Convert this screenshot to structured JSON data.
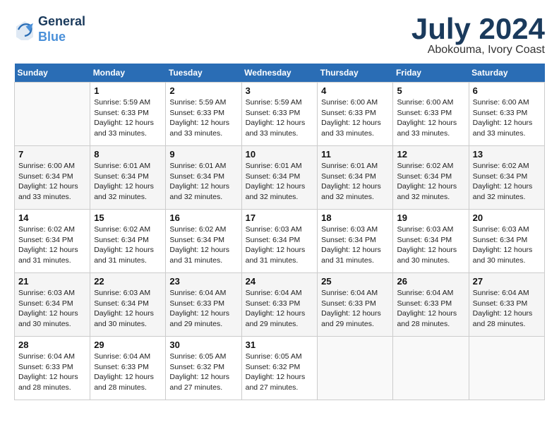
{
  "header": {
    "logo_line1": "General",
    "logo_line2": "Blue",
    "month_title": "July 2024",
    "location": "Abokouma, Ivory Coast"
  },
  "days_of_week": [
    "Sunday",
    "Monday",
    "Tuesday",
    "Wednesday",
    "Thursday",
    "Friday",
    "Saturday"
  ],
  "weeks": [
    [
      {
        "day": "",
        "info": ""
      },
      {
        "day": "1",
        "info": "Sunrise: 5:59 AM\nSunset: 6:33 PM\nDaylight: 12 hours\nand 33 minutes."
      },
      {
        "day": "2",
        "info": "Sunrise: 5:59 AM\nSunset: 6:33 PM\nDaylight: 12 hours\nand 33 minutes."
      },
      {
        "day": "3",
        "info": "Sunrise: 5:59 AM\nSunset: 6:33 PM\nDaylight: 12 hours\nand 33 minutes."
      },
      {
        "day": "4",
        "info": "Sunrise: 6:00 AM\nSunset: 6:33 PM\nDaylight: 12 hours\nand 33 minutes."
      },
      {
        "day": "5",
        "info": "Sunrise: 6:00 AM\nSunset: 6:33 PM\nDaylight: 12 hours\nand 33 minutes."
      },
      {
        "day": "6",
        "info": "Sunrise: 6:00 AM\nSunset: 6:33 PM\nDaylight: 12 hours\nand 33 minutes."
      }
    ],
    [
      {
        "day": "7",
        "info": "Sunrise: 6:00 AM\nSunset: 6:34 PM\nDaylight: 12 hours\nand 33 minutes."
      },
      {
        "day": "8",
        "info": "Sunrise: 6:01 AM\nSunset: 6:34 PM\nDaylight: 12 hours\nand 32 minutes."
      },
      {
        "day": "9",
        "info": "Sunrise: 6:01 AM\nSunset: 6:34 PM\nDaylight: 12 hours\nand 32 minutes."
      },
      {
        "day": "10",
        "info": "Sunrise: 6:01 AM\nSunset: 6:34 PM\nDaylight: 12 hours\nand 32 minutes."
      },
      {
        "day": "11",
        "info": "Sunrise: 6:01 AM\nSunset: 6:34 PM\nDaylight: 12 hours\nand 32 minutes."
      },
      {
        "day": "12",
        "info": "Sunrise: 6:02 AM\nSunset: 6:34 PM\nDaylight: 12 hours\nand 32 minutes."
      },
      {
        "day": "13",
        "info": "Sunrise: 6:02 AM\nSunset: 6:34 PM\nDaylight: 12 hours\nand 32 minutes."
      }
    ],
    [
      {
        "day": "14",
        "info": "Sunrise: 6:02 AM\nSunset: 6:34 PM\nDaylight: 12 hours\nand 31 minutes."
      },
      {
        "day": "15",
        "info": "Sunrise: 6:02 AM\nSunset: 6:34 PM\nDaylight: 12 hours\nand 31 minutes."
      },
      {
        "day": "16",
        "info": "Sunrise: 6:02 AM\nSunset: 6:34 PM\nDaylight: 12 hours\nand 31 minutes."
      },
      {
        "day": "17",
        "info": "Sunrise: 6:03 AM\nSunset: 6:34 PM\nDaylight: 12 hours\nand 31 minutes."
      },
      {
        "day": "18",
        "info": "Sunrise: 6:03 AM\nSunset: 6:34 PM\nDaylight: 12 hours\nand 31 minutes."
      },
      {
        "day": "19",
        "info": "Sunrise: 6:03 AM\nSunset: 6:34 PM\nDaylight: 12 hours\nand 30 minutes."
      },
      {
        "day": "20",
        "info": "Sunrise: 6:03 AM\nSunset: 6:34 PM\nDaylight: 12 hours\nand 30 minutes."
      }
    ],
    [
      {
        "day": "21",
        "info": "Sunrise: 6:03 AM\nSunset: 6:34 PM\nDaylight: 12 hours\nand 30 minutes."
      },
      {
        "day": "22",
        "info": "Sunrise: 6:03 AM\nSunset: 6:34 PM\nDaylight: 12 hours\nand 30 minutes."
      },
      {
        "day": "23",
        "info": "Sunrise: 6:04 AM\nSunset: 6:33 PM\nDaylight: 12 hours\nand 29 minutes."
      },
      {
        "day": "24",
        "info": "Sunrise: 6:04 AM\nSunset: 6:33 PM\nDaylight: 12 hours\nand 29 minutes."
      },
      {
        "day": "25",
        "info": "Sunrise: 6:04 AM\nSunset: 6:33 PM\nDaylight: 12 hours\nand 29 minutes."
      },
      {
        "day": "26",
        "info": "Sunrise: 6:04 AM\nSunset: 6:33 PM\nDaylight: 12 hours\nand 28 minutes."
      },
      {
        "day": "27",
        "info": "Sunrise: 6:04 AM\nSunset: 6:33 PM\nDaylight: 12 hours\nand 28 minutes."
      }
    ],
    [
      {
        "day": "28",
        "info": "Sunrise: 6:04 AM\nSunset: 6:33 PM\nDaylight: 12 hours\nand 28 minutes."
      },
      {
        "day": "29",
        "info": "Sunrise: 6:04 AM\nSunset: 6:33 PM\nDaylight: 12 hours\nand 28 minutes."
      },
      {
        "day": "30",
        "info": "Sunrise: 6:05 AM\nSunset: 6:32 PM\nDaylight: 12 hours\nand 27 minutes."
      },
      {
        "day": "31",
        "info": "Sunrise: 6:05 AM\nSunset: 6:32 PM\nDaylight: 12 hours\nand 27 minutes."
      },
      {
        "day": "",
        "info": ""
      },
      {
        "day": "",
        "info": ""
      },
      {
        "day": "",
        "info": ""
      }
    ]
  ]
}
